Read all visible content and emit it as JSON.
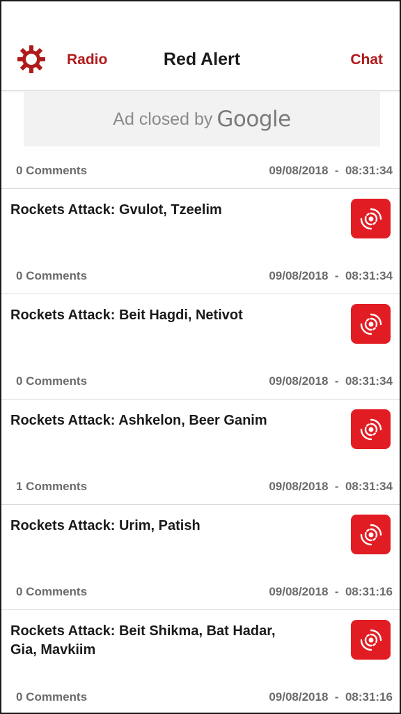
{
  "header": {
    "settings_icon": "gear-icon",
    "radio_label": "Radio",
    "title": "Red Alert",
    "chat_label": "Chat"
  },
  "ad": {
    "text": "Ad closed by",
    "brand": "Google"
  },
  "colors": {
    "accent": "#b01a1a",
    "alert_red": "#e21c23"
  },
  "top_meta": {
    "comments": "0 Comments",
    "timestamp": "09/08/2018  -  08:31:34"
  },
  "alerts": [
    {
      "title": "Rockets Attack: Gvulot, Tzeelim",
      "icon": "siren-icon",
      "comments": "0 Comments",
      "timestamp": "09/08/2018  -  08:31:34"
    },
    {
      "title": "Rockets Attack: Beit Hagdi, Netivot",
      "icon": "siren-icon",
      "comments": "0 Comments",
      "timestamp": "09/08/2018  -  08:31:34"
    },
    {
      "title": "Rockets Attack: Ashkelon, Beer Ganim",
      "icon": "siren-icon",
      "comments": "1 Comments",
      "timestamp": "09/08/2018  -  08:31:34"
    },
    {
      "title": "Rockets Attack: Urim, Patish",
      "icon": "siren-icon",
      "comments": "0 Comments",
      "timestamp": "09/08/2018  -  08:31:16"
    },
    {
      "title": "Rockets Attack: Beit Shikma, Bat Hadar, Gia, Mavkiim",
      "icon": "siren-icon",
      "comments": "0 Comments",
      "timestamp": "09/08/2018  -  08:31:16"
    }
  ]
}
